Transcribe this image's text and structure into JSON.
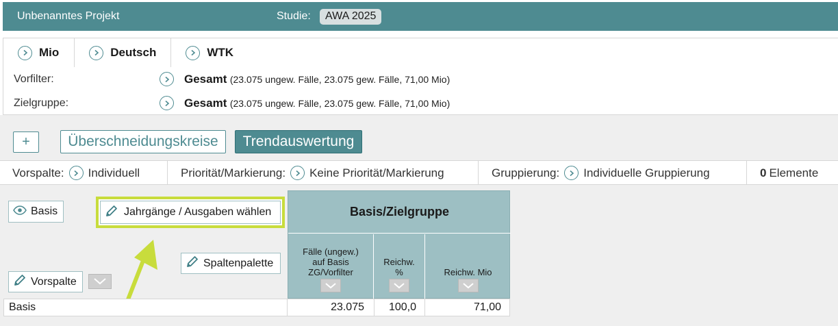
{
  "header": {
    "project_title": "Unbenanntes Projekt",
    "study_label": "Studie:",
    "study_value": "AWA 2025"
  },
  "tabs": [
    {
      "label": "Mio",
      "icon": "chevron-circle-icon"
    },
    {
      "label": "Deutsch",
      "icon": "chevron-circle-icon"
    },
    {
      "label": "WTK",
      "icon": "chevron-circle-icon"
    }
  ],
  "filters": {
    "vorfilter": {
      "label": "Vorfilter:",
      "value": "Gesamt",
      "desc": "(23.075 ungew. Fälle, 23.075 gew. Fälle, 71,00 Mio)"
    },
    "zielgruppe": {
      "label": "Zielgruppe:",
      "value": "Gesamt",
      "desc": "(23.075 ungew. Fälle, 23.075 gew. Fälle, 71,00 Mio)"
    }
  },
  "actions": {
    "add": "+",
    "overlap": "Überschneidungskreise",
    "trend": "Trendauswertung"
  },
  "options": {
    "vorspalte_label": "Vorspalte:",
    "vorspalte_value": "Individuell",
    "prio_label": "Priorität/Markierung:",
    "prio_value": "Keine Priorität/Markierung",
    "group_label": "Gruppierung:",
    "group_value": "Individuelle Gruppierung",
    "elements_count": "0",
    "elements_label": "Elemente"
  },
  "table": {
    "basis_button": "Basis",
    "choose_years_button": "Jahrgänge / Ausgaben wählen",
    "column_palette_button": "Spaltenpalette",
    "vorspalte_button": "Vorspalte",
    "group_title": "Basis/Zielgruppe",
    "columns": [
      {
        "line1": "Fälle (ungew.)",
        "line2": "auf Basis",
        "line3": "ZG/Vorfilter"
      },
      {
        "line1": "Reichw.",
        "line2": "%",
        "line3": ""
      },
      {
        "line1": "Reichw. Mio",
        "line2": "",
        "line3": ""
      }
    ],
    "rows": [
      {
        "label": "Basis",
        "values": [
          "23.075",
          "100,0",
          "71,00"
        ]
      }
    ]
  },
  "colors": {
    "accent": "#4e8b91",
    "header_cell": "#9dbfc3",
    "highlight": "#c8dc3c",
    "annotation_arrow": "#c8dc3c"
  }
}
